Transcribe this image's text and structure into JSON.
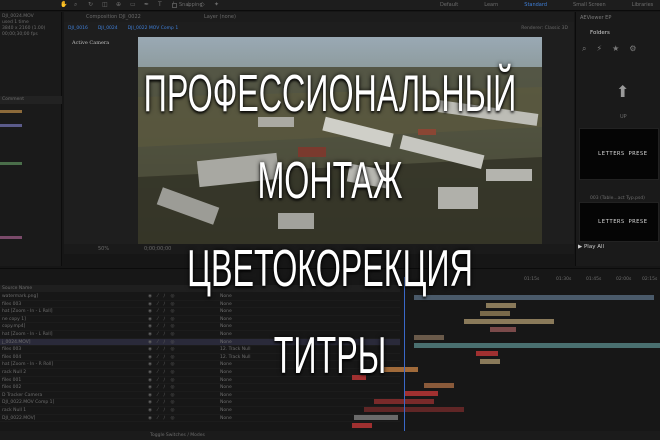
{
  "menubar": {
    "snap_label": "Snapping",
    "workspaces": [
      "Default",
      "Learn",
      "Standard",
      "Small Screen",
      "Libraries"
    ],
    "active_workspace": "Standard"
  },
  "project": {
    "info_lines": [
      "DJI_0024.MOV",
      "used 1 time",
      "3840 x 2160 (1.00)",
      "00;00;30;00 fps"
    ],
    "column_label": "Comment"
  },
  "viewer": {
    "tabs": [
      "Composition DJI_0022",
      "Layer (none)"
    ],
    "comp_tabs": [
      "DJI_0016",
      "DJI_0024",
      "DJI_0022 MOV Comp 1"
    ],
    "active_camera": "Active Camera",
    "renderer": "Renderer: Classic 3D",
    "zoom": "50%",
    "timecode": "0;00;00;00"
  },
  "right_panel": {
    "title": "AEViewer EP",
    "folders_label": "Folders",
    "up_label": "UP",
    "preset_label": "LETTERS PRESE",
    "preset_name": "003 (Table...act Typ.psd)",
    "play_all": "Play All"
  },
  "timeline": {
    "ruler": [
      "01:15s",
      "01:30s",
      "01:45s",
      "02:00s",
      "02:15s"
    ],
    "header": "Source Name",
    "footer": "Toggle Switches / Modes",
    "layers": [
      {
        "name": "watermark.png]",
        "mode": "None"
      },
      {
        "name": "files 003",
        "mode": "None"
      },
      {
        "name": "hat [Zoom - In - L Roll]",
        "mode": "None"
      },
      {
        "name": "ne copy 1]",
        "mode": "None"
      },
      {
        "name": "copy.mp4]",
        "mode": "None"
      },
      {
        "name": "hat [Zoom - In - L Roll]",
        "mode": "None"
      },
      {
        "name": "j_0024.MOV]",
        "mode": "None"
      },
      {
        "name": "files 003",
        "mode": "12. Track Null"
      },
      {
        "name": "files 004",
        "mode": "12. Track Null"
      },
      {
        "name": "hat [Zoom - In - R Roll]",
        "mode": "None"
      },
      {
        "name": "rack Null 2",
        "mode": "None"
      },
      {
        "name": "files 001",
        "mode": "None"
      },
      {
        "name": "files 002",
        "mode": "None"
      },
      {
        "name": "D Tracker Camera",
        "mode": "None"
      },
      {
        "name": "DJI_0022.MOV Comp 1]",
        "mode": "None"
      },
      {
        "name": "rack Null 1",
        "mode": "None"
      },
      {
        "name": "DJI_0022.MOV]",
        "mode": "None"
      }
    ]
  },
  "overlay": {
    "line1": "ПРОФЕССИОНАЛЬНЫЙ",
    "line2": "МОНТАЖ",
    "line3": "ЦВЕТОКОРЕКЦИЯ",
    "line4": "ТИТРЫ"
  },
  "colors": {
    "accent": "#3f7fd8",
    "overlay_text": "#ffffff",
    "bar_tan": "#8a7a5a",
    "bar_red": "#a03030",
    "bar_teal": "#4a7070"
  }
}
